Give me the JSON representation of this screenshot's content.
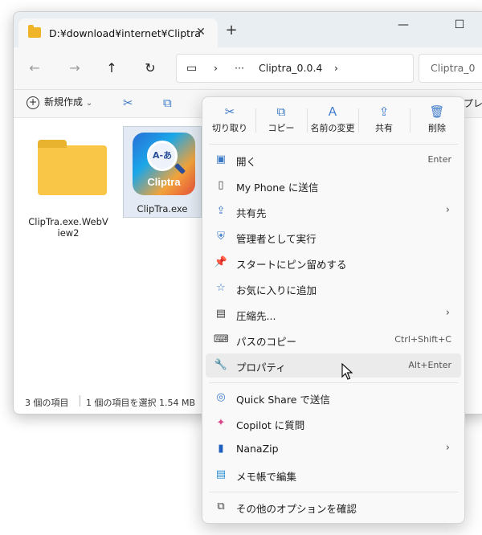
{
  "window": {
    "tab_title": "D:¥download¥internet¥Cliptra",
    "tab_close": "✕",
    "new_tab": "+",
    "minimize": "—",
    "maximize": "☐"
  },
  "nav": {
    "back": "←",
    "forward": "→",
    "up": "↑",
    "refresh": "↻",
    "monitor_icon": "▭",
    "chevron": "›",
    "ellipsis": "···",
    "breadcrumb_current": "Cliptra_0.0.4",
    "search_placeholder": "Cliptra_0"
  },
  "commandbar": {
    "new_label": "新規作成",
    "new_chevron": "⌄",
    "cut_icon": "✂",
    "copy_icon": "⧉",
    "preview_label": "プレビ"
  },
  "files": [
    {
      "name": "ClipTra.exe.WebView2",
      "line1": "ClipTra.exe.WebV",
      "line2": "iew2",
      "type": "folder"
    },
    {
      "name": "ClipTra.exe",
      "type": "app",
      "icon_text": "A-あ",
      "icon_brand": "Cliptra"
    }
  ],
  "status": {
    "count": "3 個の項目",
    "selected": "1 個の項目を選択  1.54 MB"
  },
  "context_menu": {
    "top_actions": [
      {
        "label": "切り取り",
        "icon": "✂"
      },
      {
        "label": "コピー",
        "icon": "⧉"
      },
      {
        "label": "名前の変更",
        "icon": "Ａ"
      },
      {
        "label": "共有",
        "icon": "⇪"
      },
      {
        "label": "削除",
        "icon": "🗑"
      }
    ],
    "items": [
      {
        "label": "開く",
        "shortcut": "Enter",
        "icon": "▣"
      },
      {
        "label": "My Phone に送信",
        "shortcut": "",
        "icon": "▯"
      },
      {
        "label": "共有先",
        "shortcut": "",
        "icon": "⇪",
        "submenu": "›"
      },
      {
        "label": "管理者として実行",
        "shortcut": "",
        "icon": "⛨"
      },
      {
        "label": "スタートにピン留めする",
        "shortcut": "",
        "icon": "📌"
      },
      {
        "label": "お気に入りに追加",
        "shortcut": "",
        "icon": "☆"
      },
      {
        "label": "圧縮先...",
        "shortcut": "",
        "icon": "▤",
        "submenu": "›"
      },
      {
        "label": "パスのコピー",
        "shortcut": "Ctrl+Shift+C",
        "icon": "⌨"
      },
      {
        "label": "プロパティ",
        "shortcut": "Alt+Enter",
        "icon": "🔧"
      }
    ],
    "items2": [
      {
        "label": "Quick Share で送信",
        "icon": "◎"
      },
      {
        "label": "Copilot に質問",
        "icon": "✦"
      },
      {
        "label": "NanaZip",
        "icon": "▮",
        "submenu": "›"
      },
      {
        "label": "メモ帳で編集",
        "icon": "▤"
      }
    ],
    "more": {
      "label": "その他のオプションを確認",
      "icon": "⧉"
    }
  }
}
